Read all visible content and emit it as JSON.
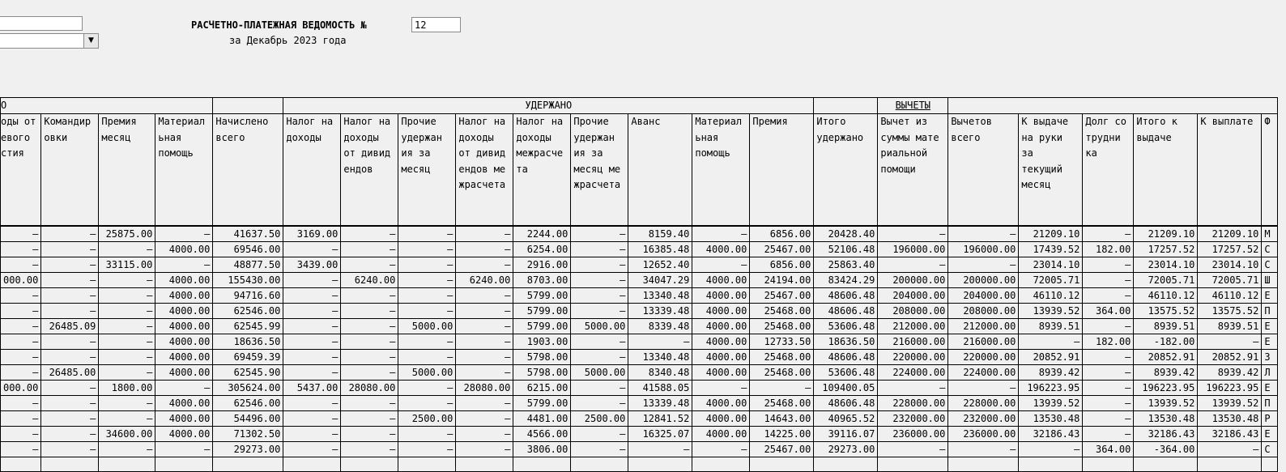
{
  "header": {
    "title": "РАСЧЕТНО-ПЛАТЕЖНАЯ ВЕДОМОСТЬ №",
    "number": "12",
    "period": "за Декабрь 2023 года"
  },
  "groups": {
    "accrued_partial": "О",
    "withheld": "УДЕРЖАНО",
    "vychety": "ВЫЧЕТЫ"
  },
  "columns": [
    "оды от\nевого\nстия",
    "Командир\nовки",
    "Премия\nмесяц",
    "Материал\nьная\nпомощь",
    "Начислено\nвсего",
    "Налог на\nдоходы",
    "Налог на\nдоходы\nот дивид\nендов",
    "Прочие\nудержан\nия за\nмесяц",
    "Налог на\nдоходы\nот дивид\nендов ме\nжрасчета",
    "Налог на\nдоходы\nмежрасче\nта",
    "Прочие\nудержан\nия за\nмесяц ме\nжрасчета",
    "Аванс",
    "Материал\nьная\nпомощь",
    "Премия",
    "Итого\nудержано",
    "Вычет из\nсуммы мате\nриальной\nпомощи",
    "Вычетов\nвсего",
    "К выдаче\nна руки\nза\nтекущий\nмесяц",
    "Долг со\nтрудни\nка",
    "Итого к\nвыдаче",
    "К выплате",
    "Ф"
  ],
  "rows": [
    [
      "–",
      "–",
      "25875.00",
      "–",
      "41637.50",
      "3169.00",
      "–",
      "–",
      "–",
      "2244.00",
      "–",
      "8159.40",
      "–",
      "6856.00",
      "20428.40",
      "–",
      "–",
      "21209.10",
      "–",
      "21209.10",
      "21209.10",
      "М"
    ],
    [
      "–",
      "–",
      "–",
      "4000.00",
      "69546.00",
      "–",
      "–",
      "–",
      "–",
      "6254.00",
      "–",
      "16385.48",
      "4000.00",
      "25467.00",
      "52106.48",
      "196000.00",
      "196000.00",
      "17439.52",
      "182.00",
      "17257.52",
      "17257.52",
      "С"
    ],
    [
      "–",
      "–",
      "33115.00",
      "–",
      "48877.50",
      "3439.00",
      "–",
      "–",
      "–",
      "2916.00",
      "–",
      "12652.40",
      "–",
      "6856.00",
      "25863.40",
      "–",
      "–",
      "23014.10",
      "–",
      "23014.10",
      "23014.10",
      "С"
    ],
    [
      "000.00",
      "–",
      "–",
      "4000.00",
      "155430.00",
      "–",
      "6240.00",
      "–",
      "6240.00",
      "8703.00",
      "–",
      "34047.29",
      "4000.00",
      "24194.00",
      "83424.29",
      "200000.00",
      "200000.00",
      "72005.71",
      "–",
      "72005.71",
      "72005.71",
      "Ш"
    ],
    [
      "–",
      "–",
      "–",
      "4000.00",
      "94716.60",
      "–",
      "–",
      "–",
      "–",
      "5799.00",
      "–",
      "13340.48",
      "4000.00",
      "25467.00",
      "48606.48",
      "204000.00",
      "204000.00",
      "46110.12",
      "–",
      "46110.12",
      "46110.12",
      "Е"
    ],
    [
      "–",
      "–",
      "–",
      "4000.00",
      "62546.00",
      "–",
      "–",
      "–",
      "–",
      "5799.00",
      "–",
      "13339.48",
      "4000.00",
      "25468.00",
      "48606.48",
      "208000.00",
      "208000.00",
      "13939.52",
      "364.00",
      "13575.52",
      "13575.52",
      "П"
    ],
    [
      "–",
      "26485.09",
      "–",
      "4000.00",
      "62545.99",
      "–",
      "–",
      "5000.00",
      "–",
      "5799.00",
      "5000.00",
      "8339.48",
      "4000.00",
      "25468.00",
      "53606.48",
      "212000.00",
      "212000.00",
      "8939.51",
      "–",
      "8939.51",
      "8939.51",
      "Е"
    ],
    [
      "–",
      "–",
      "–",
      "4000.00",
      "18636.50",
      "–",
      "–",
      "–",
      "–",
      "1903.00",
      "–",
      "–",
      "4000.00",
      "12733.50",
      "18636.50",
      "216000.00",
      "216000.00",
      "–",
      "182.00",
      "-182.00",
      "–",
      "Е"
    ],
    [
      "–",
      "–",
      "–",
      "4000.00",
      "69459.39",
      "–",
      "–",
      "–",
      "–",
      "5798.00",
      "–",
      "13340.48",
      "4000.00",
      "25468.00",
      "48606.48",
      "220000.00",
      "220000.00",
      "20852.91",
      "–",
      "20852.91",
      "20852.91",
      "З"
    ],
    [
      "–",
      "26485.00",
      "–",
      "4000.00",
      "62545.90",
      "–",
      "–",
      "5000.00",
      "–",
      "5798.00",
      "5000.00",
      "8340.48",
      "4000.00",
      "25468.00",
      "53606.48",
      "224000.00",
      "224000.00",
      "8939.42",
      "–",
      "8939.42",
      "8939.42",
      "Л"
    ],
    [
      "000.00",
      "–",
      "1800.00",
      "–",
      "305624.00",
      "5437.00",
      "28080.00",
      "–",
      "28080.00",
      "6215.00",
      "–",
      "41588.05",
      "–",
      "–",
      "109400.05",
      "–",
      "–",
      "196223.95",
      "–",
      "196223.95",
      "196223.95",
      "Е"
    ],
    [
      "–",
      "–",
      "–",
      "4000.00",
      "62546.00",
      "–",
      "–",
      "–",
      "–",
      "5799.00",
      "–",
      "13339.48",
      "4000.00",
      "25468.00",
      "48606.48",
      "228000.00",
      "228000.00",
      "13939.52",
      "–",
      "13939.52",
      "13939.52",
      "П"
    ],
    [
      "–",
      "–",
      "–",
      "4000.00",
      "54496.00",
      "–",
      "–",
      "2500.00",
      "–",
      "4481.00",
      "2500.00",
      "12841.52",
      "4000.00",
      "14643.00",
      "40965.52",
      "232000.00",
      "232000.00",
      "13530.48",
      "–",
      "13530.48",
      "13530.48",
      "Р"
    ],
    [
      "–",
      "–",
      "34600.00",
      "4000.00",
      "71302.50",
      "–",
      "–",
      "–",
      "–",
      "4566.00",
      "–",
      "16325.07",
      "4000.00",
      "14225.00",
      "39116.07",
      "236000.00",
      "236000.00",
      "32186.43",
      "–",
      "32186.43",
      "32186.43",
      "Е"
    ],
    [
      "–",
      "–",
      "–",
      "–",
      "29273.00",
      "–",
      "–",
      "–",
      "–",
      "3806.00",
      "–",
      "–",
      "–",
      "25467.00",
      "29273.00",
      "–",
      "–",
      "–",
      "364.00",
      "-364.00",
      "–",
      "С"
    ],
    [
      "",
      "",
      "",
      "",
      "",
      "",
      "",
      "",
      "",
      "",
      "",
      "",
      "",
      "",
      "",
      "",
      "",
      "",
      "",
      "",
      "",
      ""
    ]
  ]
}
